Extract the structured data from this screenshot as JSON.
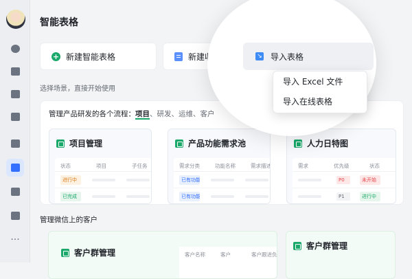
{
  "page": {
    "title": "智能表格",
    "hint": "选择场景，直接开始使用"
  },
  "sidebar": {
    "items": [
      {
        "name": "chat-icon"
      },
      {
        "name": "mail-icon"
      },
      {
        "name": "upload-icon"
      },
      {
        "name": "calendar-icon"
      },
      {
        "name": "chart-icon"
      },
      {
        "name": "smart-sheet-icon",
        "active": true
      },
      {
        "name": "apps-grid-icon"
      },
      {
        "name": "org-chart-icon"
      },
      {
        "name": "more-icon"
      }
    ]
  },
  "actions": {
    "new_sheet": "新建智能表格",
    "new_collect": "新建收集",
    "import_sheet": "导入表格"
  },
  "dropdown": {
    "items": [
      "导入 Excel 文件",
      "导入在线表格"
    ]
  },
  "section1": {
    "title_prefix": "管理产品研发的各个流程：",
    "current": "项目",
    "others": "、研发、运维、客户",
    "cards": [
      {
        "title": "项目管理",
        "headers": [
          "状态",
          "项目",
          "子任务"
        ],
        "rows": [
          {
            "tag": "进行中",
            "color": "orange"
          },
          {
            "tag": "已完成",
            "color": "green"
          }
        ]
      },
      {
        "title": "产品功能需求池",
        "headers": [
          "需求分类",
          "功能名称",
          "需求描述"
        ],
        "rows": [
          {
            "tag": "已有功能...",
            "color": "blue"
          },
          {
            "tag": "已有功能...",
            "color": "blue"
          }
        ]
      },
      {
        "title": "人力日特图",
        "headers": [
          "需求",
          "优先级",
          "状态"
        ],
        "rows": [
          {
            "tag1": "P0",
            "tag2": "未开始"
          },
          {
            "tag1": "P1",
            "tag2": "进行中"
          }
        ]
      }
    ]
  },
  "section2": {
    "title": "管理微信上的客户",
    "cards": [
      {
        "title": "客户群管理",
        "headers": [
          "客户名称",
          "客户",
          "客户跟进负"
        ]
      },
      {
        "title": "客户群管理"
      }
    ]
  },
  "colors": {
    "accent_blue": "#3370ff",
    "accent_green": "#1aa96a"
  }
}
